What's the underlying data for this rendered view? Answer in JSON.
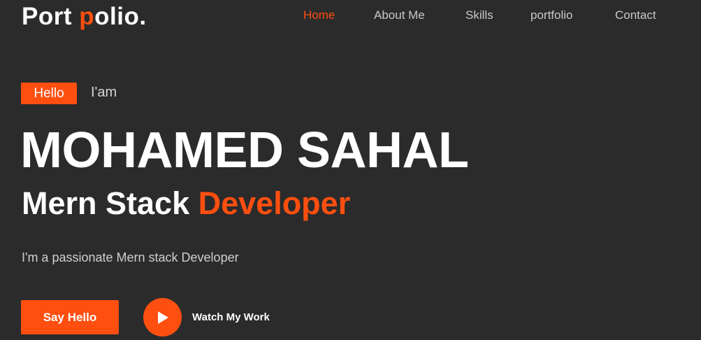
{
  "logo": {
    "part1": "Port ",
    "accent": "p",
    "part2": "olio."
  },
  "nav": {
    "items": [
      {
        "label": "Home",
        "active": true
      },
      {
        "label": "About Me",
        "active": false
      },
      {
        "label": "Skills",
        "active": false
      },
      {
        "label": "portfolio",
        "active": false
      },
      {
        "label": "Contact",
        "active": false
      }
    ]
  },
  "hero": {
    "badge": "Hello",
    "intro": "I'am",
    "name": "MOHAMED SAHAL",
    "role_prefix": "Mern Stack ",
    "role_accent": "Developer",
    "tagline": "I'm a passionate Mern stack Developer",
    "cta_label": "Say Hello",
    "watch_label": "Watch My Work"
  },
  "colors": {
    "accent": "#fe4f10",
    "background": "#2b2b2b"
  },
  "icons": {
    "play": "play-icon"
  }
}
